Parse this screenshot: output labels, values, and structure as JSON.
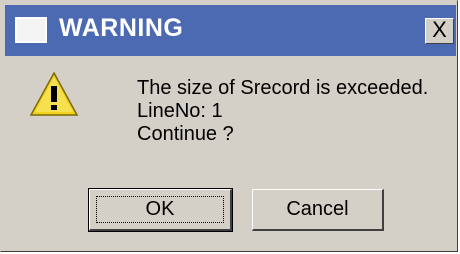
{
  "window": {
    "title": "WARNING",
    "close_label": "X"
  },
  "message": {
    "line1": "The size of Srecord is exceeded.",
    "line2": "LineNo: 1",
    "line3": "Continue ?"
  },
  "buttons": {
    "ok_label": "OK",
    "cancel_label": "Cancel"
  },
  "icons": {
    "title_icon": "window-icon",
    "message_icon": "warning-icon"
  },
  "colors": {
    "titlebar": "#4b6ab2",
    "dialog_bg": "#d4d0c8",
    "warning_yellow": "#f2d21e"
  }
}
